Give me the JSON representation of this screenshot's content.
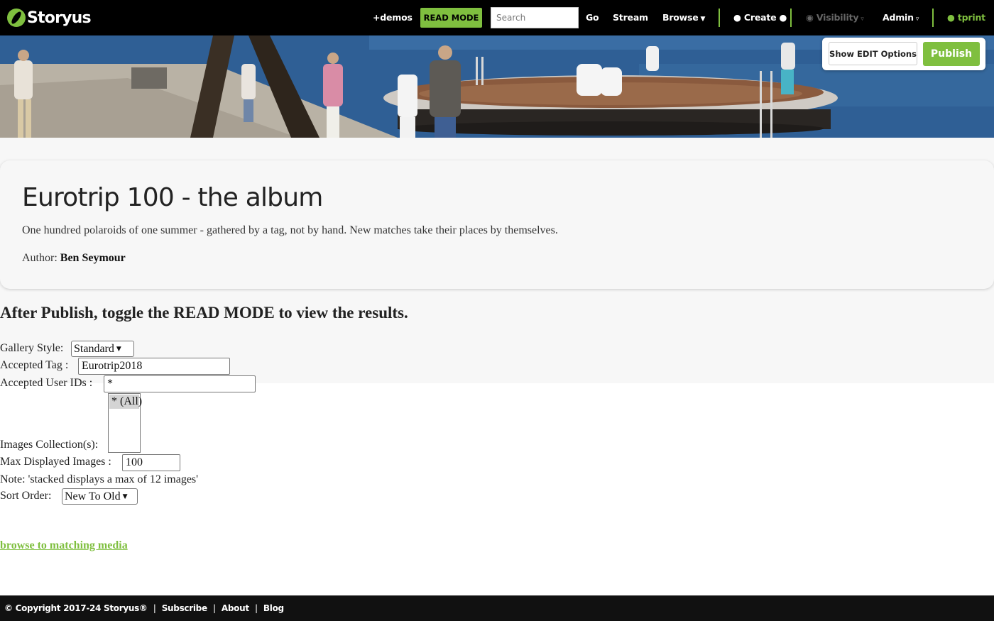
{
  "nav": {
    "brand": "Storyus",
    "demos": "+demos",
    "read_mode": "READ MODE",
    "search_placeholder": "Search",
    "go": "Go",
    "stream": "Stream",
    "browse": "Browse",
    "create": "Create",
    "visibility": "Visibility",
    "admin": "Admin",
    "user": "tprint",
    "icons": {
      "logo": "storyus-leaf-logo",
      "visibility": "eye-icon",
      "dropdown": "caret-down-icon"
    }
  },
  "hero_actions": {
    "show_edit": "Show EDIT Options",
    "publish": "Publish"
  },
  "album": {
    "title": "Eurotrip 100 - the album",
    "description": "One hundred polaroids of one summer - gathered by a tag, not by hand. New matches take their places by themselves.",
    "author_label": "Author:",
    "author_name": "Ben Seymour"
  },
  "instructions": "After Publish, toggle the READ MODE to view the results.",
  "form": {
    "gallery_style_label": "Gallery Style:",
    "gallery_style_value": "Standard",
    "accepted_tag_label": "Accepted Tag :",
    "accepted_tag_value": "Eurotrip2018",
    "accepted_users_label": "Accepted User IDs :",
    "accepted_users_value": "*",
    "collections_label": "Images Collection(s):",
    "collections_options": [
      "* (All)"
    ],
    "max_images_label": "Max Displayed Images :",
    "max_images_value": "100",
    "note": "Note: 'stacked displays a max of 12 images'",
    "sort_order_label": "Sort Order:",
    "sort_order_value": "New To Old"
  },
  "browse_link": "browse to matching media",
  "footer": {
    "copyright": "© Copyright 2017-24 Storyus®",
    "subscribe": "Subscribe",
    "about": "About",
    "blog": "Blog"
  },
  "colors": {
    "accent": "#7fbf3f",
    "nav_bg": "#000000",
    "band_bg": "#f7f7f7",
    "footer_bg": "#111111"
  }
}
